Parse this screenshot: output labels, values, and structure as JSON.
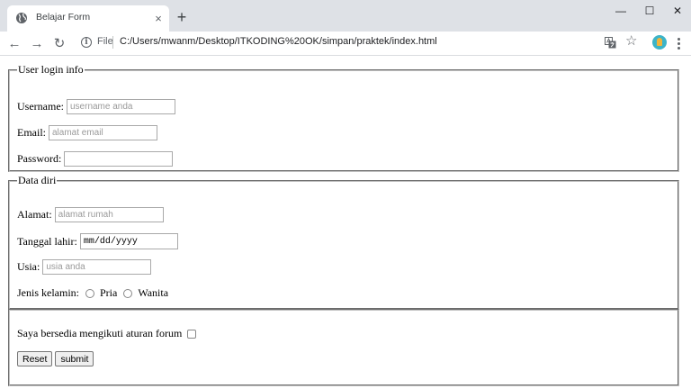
{
  "browser": {
    "tab_title": "Belajar Form",
    "tab_close": "×",
    "new_tab": "+",
    "window_controls": {
      "minimize": "—",
      "maximize": "☐",
      "close": "✕"
    },
    "nav": {
      "back": "←",
      "forward": "→",
      "reload": "↻"
    },
    "address": {
      "scheme": "File",
      "url": "C:/Users/mwanm/Desktop/ITKODING%20OK/simpan/praktek/index.html"
    },
    "icons": [
      "globe-icon",
      "close-icon",
      "info-icon",
      "translate-icon",
      "star-icon",
      "avatar",
      "kebab-menu-icon"
    ]
  },
  "form": {
    "login": {
      "legend": "User login info",
      "username_label": "Username:",
      "username_placeholder": "username anda",
      "email_label": "Email:",
      "email_placeholder": "alamat email",
      "password_label": "Password:"
    },
    "personal": {
      "legend": "Data diri",
      "address_label": "Alamat:",
      "address_placeholder": "alamat rumah",
      "dob_label": "Tanggal lahir:",
      "dob_placeholder": "mm/dd/yyyy",
      "age_label": "Usia:",
      "age_placeholder": "usia anda",
      "gender_label": "Jenis kelamin:",
      "gender_options": [
        "Pria",
        "Wanita"
      ]
    },
    "agreement": {
      "label": "Saya bersedia mengikuti aturan forum",
      "reset_label": "Reset",
      "submit_label": "submit"
    }
  }
}
